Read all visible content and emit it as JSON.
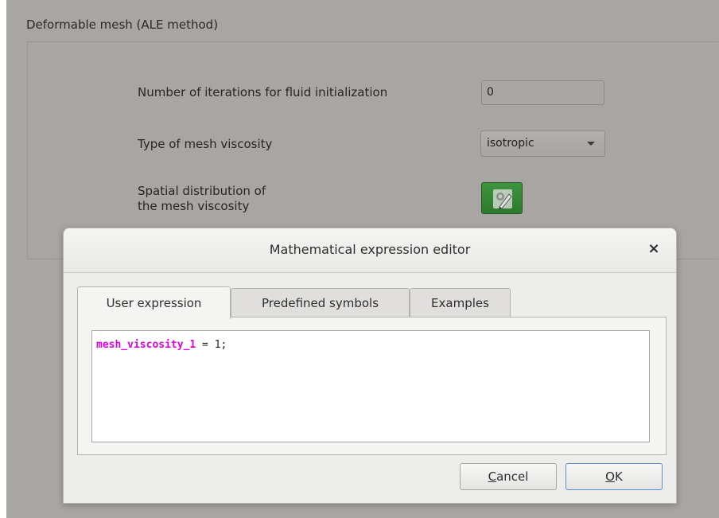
{
  "group": {
    "title": "Deformable mesh (ALE method)",
    "iterations_label": "Number of iterations for fluid initialization",
    "iterations_value": "0",
    "viscosity_type_label": "Type of mesh viscosity",
    "viscosity_type_value": "isotropic",
    "spatial_label_line1": "Spatial distribution of",
    "spatial_label_line2": "the mesh viscosity",
    "formula_button_icon": "formula-edit-icon"
  },
  "dialog": {
    "title": "Mathematical expression editor",
    "close_symbol": "×",
    "tabs": [
      {
        "label": "User expression",
        "active": true
      },
      {
        "label": "Predefined symbols",
        "active": false
      },
      {
        "label": "Examples",
        "active": false
      }
    ],
    "expression": {
      "variable": "mesh_viscosity_1",
      "rest": " = 1;"
    },
    "cancel_label": "Cancel",
    "ok_label": "OK"
  },
  "colors": {
    "background": "#a8a5a2",
    "dialog_bg": "#ededeb",
    "formula_button": "#2e7d32",
    "code_variable": "#e000e0",
    "ok_focus_border": "#5a8fd0"
  }
}
